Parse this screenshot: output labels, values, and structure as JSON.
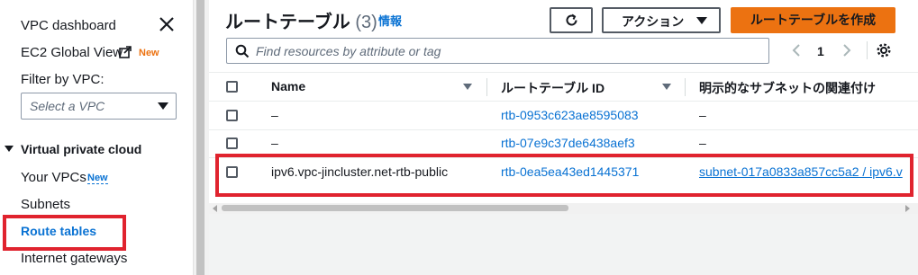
{
  "sidebar": {
    "dashboard": "VPC dashboard",
    "ec2_global_view": "EC2 Global View",
    "ec2_new_badge": "New",
    "filter_label": "Filter by VPC:",
    "filter_placeholder": "Select a VPC",
    "section_title": "Virtual private cloud",
    "your_vpcs": "Your VPCs",
    "your_vpcs_badge": "New",
    "subnets": "Subnets",
    "route_tables": "Route tables",
    "internet_gateways": "Internet gateways"
  },
  "header": {
    "title": "ルートテーブル",
    "count": "(3)",
    "info": "情報",
    "actions_label": "アクション",
    "create_label": "ルートテーブルを作成"
  },
  "search": {
    "placeholder": "Find resources by attribute or tag"
  },
  "pagination": {
    "current_page": "1"
  },
  "table": {
    "columns": [
      "Name",
      "ルートテーブル ID",
      "明示的なサブネットの関連付け"
    ],
    "rows": [
      {
        "name": "–",
        "id": "rtb-0953c623ae8595083",
        "subnet": "–"
      },
      {
        "name": "–",
        "id": "rtb-07e9c37de6438aef3",
        "subnet": "–"
      },
      {
        "name": "ipv6.vpc-jincluster.net-rtb-public",
        "id": "rtb-0ea5ea43ed1445371",
        "subnet": "subnet-017a0833a857cc5a2 / ipv6.v"
      }
    ]
  },
  "colors": {
    "accent_orange": "#ec7211",
    "link_blue": "#0972d3",
    "highlight_red": "#e0232e"
  }
}
